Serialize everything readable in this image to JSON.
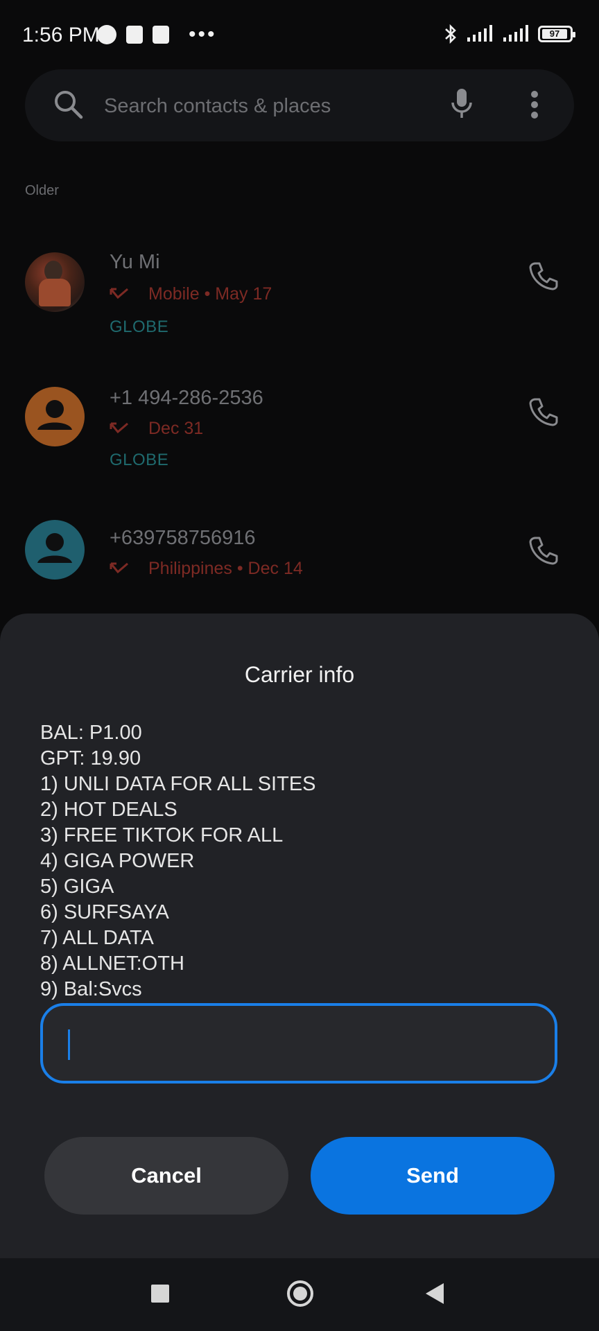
{
  "status_bar": {
    "time": "1:56 PM",
    "battery": "97"
  },
  "search": {
    "placeholder": "Search contacts & places"
  },
  "section_label": "Older",
  "calls": [
    {
      "name": "Yu Mi",
      "detail": "Mobile • May 17",
      "carrier": "GLOBE"
    },
    {
      "name": "+1 494-286-2536",
      "detail": "Dec 31",
      "carrier": "GLOBE"
    },
    {
      "name": "+639758756916",
      "detail": "Philippines • Dec 14",
      "carrier": ""
    }
  ],
  "dialog": {
    "title": "Carrier info",
    "lines": [
      "BAL: P1.00",
      "GPT: 19.90",
      "1) UNLI DATA FOR ALL SITES",
      "2) HOT DEALS",
      "3) FREE TIKTOK FOR ALL",
      "4) GIGA POWER",
      "5) GIGA",
      "6) SURFSAYA",
      "7) ALL DATA",
      "8) ALLNET:OTH",
      "9) Bal:Svcs"
    ],
    "input_value": "",
    "cancel_label": "Cancel",
    "send_label": "Send"
  },
  "colors": {
    "accent": "#0a74e0",
    "missed_call": "#7d2a24",
    "carrier_label": "#1f6a6e",
    "sheet_bg": "#212226"
  }
}
